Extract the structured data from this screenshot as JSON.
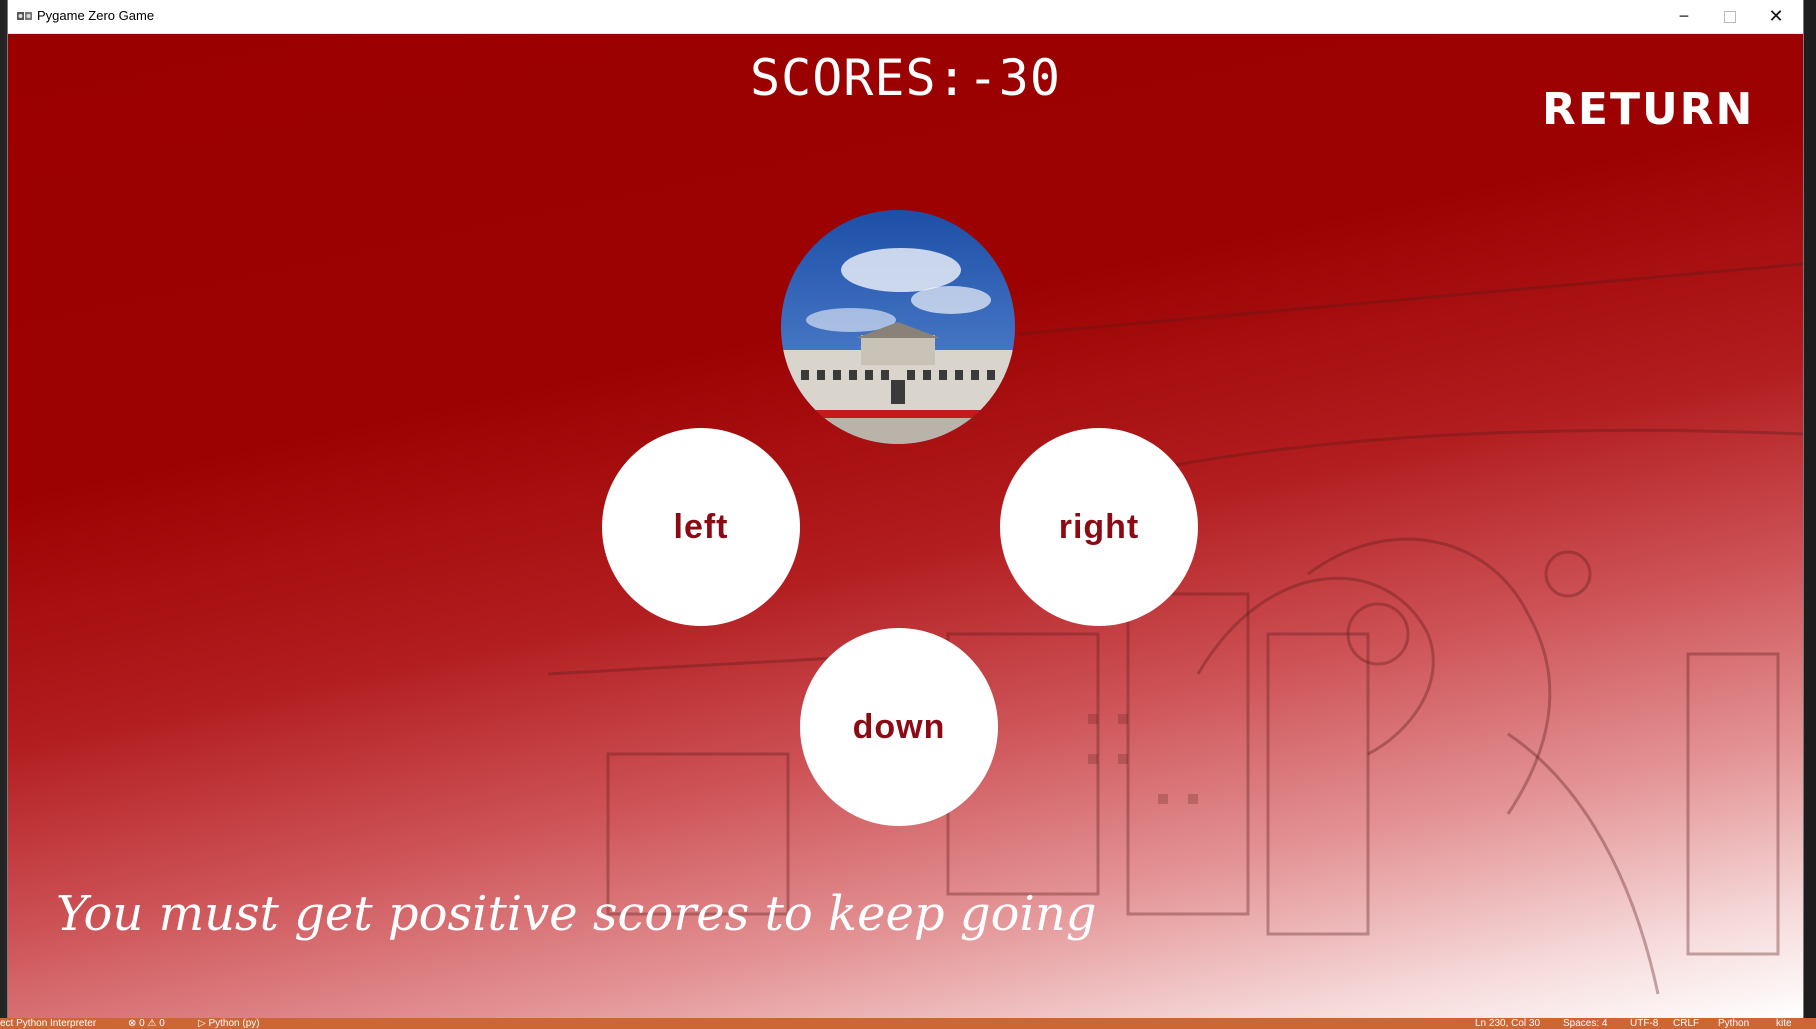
{
  "window": {
    "title": "Pygame Zero Game",
    "controls": {
      "minimize": "─",
      "close": "✕"
    }
  },
  "game": {
    "score_text": "SCORES:-30",
    "return_label": "RETURN",
    "photo": "palace-gate-under-blue-sky",
    "buttons": {
      "left": "left",
      "right": "right",
      "down": "down"
    },
    "hint": "You must get positive scores to keep going",
    "colors": {
      "background_top": "#9b0000",
      "button_text": "#8b0a14",
      "text": "#ffffff"
    }
  },
  "statusbar": {
    "interpreter": "ect Python Interpreter",
    "problems": "⊗ 0 ⚠ 0",
    "language_mode": "▷ Python (py)",
    "cursor": "Ln 230, Col 30",
    "spaces": "Spaces: 4",
    "encoding": "UTF-8",
    "eol": "CRLF",
    "language": "Python",
    "extra": "kite"
  }
}
